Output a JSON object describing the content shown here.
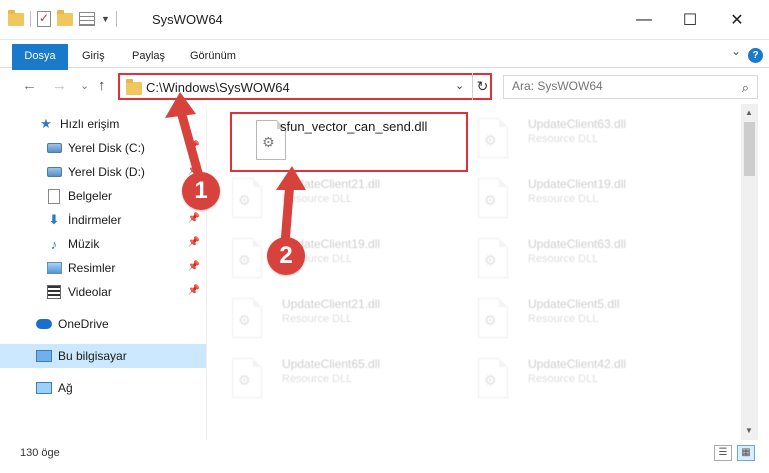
{
  "window": {
    "title": "SysWOW64",
    "minimize_glyph": "—",
    "maximize_glyph": "☐",
    "close_glyph": "✕"
  },
  "ribbon": {
    "tabs": [
      "Dosya",
      "Giriş",
      "Paylaş",
      "Görünüm"
    ],
    "collapse_glyph": "⌄",
    "help_glyph": "?"
  },
  "address": {
    "path": "C:\\Windows\\SysWOW64",
    "search_placeholder": "Ara: SysWOW64",
    "back_glyph": "←",
    "forward_glyph": "→",
    "recent_glyph": "⌄",
    "up_glyph": "↑",
    "dropdown_glyph": "⌄",
    "refresh_glyph": "↻"
  },
  "nav": {
    "items": [
      {
        "label": "Hızlı erişim",
        "icon": "star-icon",
        "pinned": false
      },
      {
        "label": "Yerel Disk (C:)",
        "icon": "drive-icon",
        "pinned": true
      },
      {
        "label": "Yerel Disk (D:)",
        "icon": "drive-icon",
        "pinned": true
      },
      {
        "label": "Belgeler",
        "icon": "document-icon",
        "pinned": true
      },
      {
        "label": "İndirmeler",
        "icon": "download-icon",
        "pinned": true
      },
      {
        "label": "Müzik",
        "icon": "music-icon",
        "pinned": true
      },
      {
        "label": "Resimler",
        "icon": "pictures-icon",
        "pinned": true
      },
      {
        "label": "Videolar",
        "icon": "video-icon",
        "pinned": true
      },
      {
        "label": "OneDrive",
        "icon": "cloud-icon",
        "pinned": false
      },
      {
        "label": "Bu bilgisayar",
        "icon": "computer-icon",
        "pinned": false
      },
      {
        "label": "Ağ",
        "icon": "network-icon",
        "pinned": false
      }
    ],
    "pin_glyph": "📌"
  },
  "files": [
    {
      "name": "sfun_vector_can_send.dll",
      "type": ""
    },
    {
      "name": "UpdateClient63.dll",
      "type": "Resource DLL"
    },
    {
      "name": "UpdateClient21.dll",
      "type": "Resource DLL"
    },
    {
      "name": "UpdateClient19.dll",
      "type": "Resource DLL"
    },
    {
      "name": "UpdateClient19.dll",
      "type": "Resource DLL"
    },
    {
      "name": "UpdateClient63.dll",
      "type": "Resource DLL"
    },
    {
      "name": "UpdateClient21.dll",
      "type": "Resource DLL"
    },
    {
      "name": "UpdateClient5.dll",
      "type": "Resource DLL"
    },
    {
      "name": "UpdateClient65.dll",
      "type": "Resource DLL"
    },
    {
      "name": "UpdateClient42.dll",
      "type": "Resource DLL"
    }
  ],
  "status": {
    "item_count": "130 öge"
  },
  "annotations": {
    "step1": "1",
    "step2": "2"
  },
  "colors": {
    "accent": "#1979ca",
    "highlight_border": "#e0303a",
    "callout": "#d8423c",
    "selected_nav": "#cce8ff"
  }
}
